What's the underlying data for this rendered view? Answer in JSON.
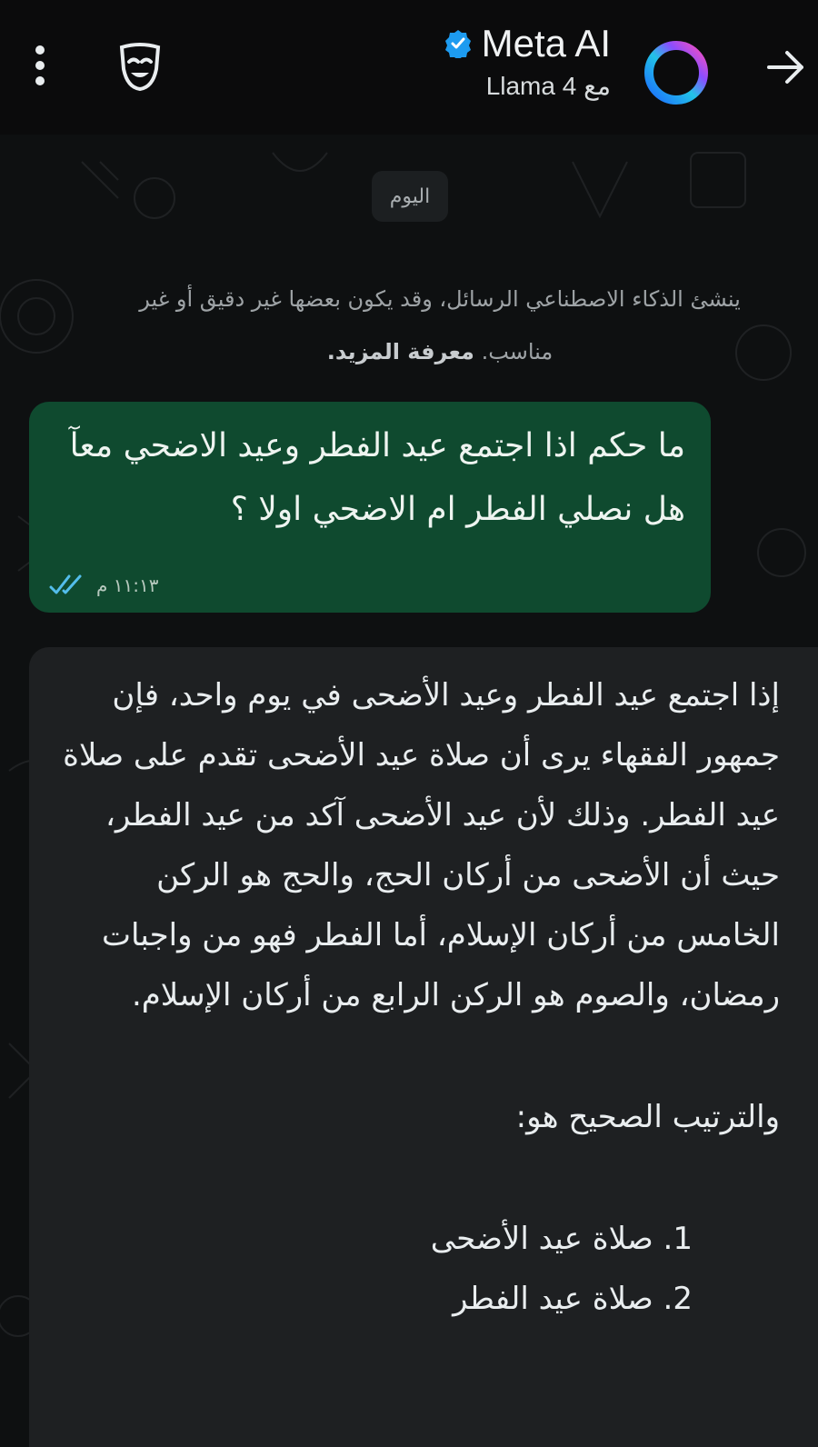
{
  "header": {
    "title": "Meta AI",
    "subtitle": "مع Llama 4",
    "icons": [
      "more-vertical-icon",
      "mask-icon",
      "verified-badge-icon",
      "meta-ai-ring-icon",
      "arrow-right-icon"
    ]
  },
  "chat": {
    "date_chip": "اليوم",
    "notice_text": "ينشئ الذكاء الاصطناعي الرسائل، وقد يكون بعضها غير دقيق أو غير مناسب.",
    "notice_link": "معرفة المزيد.",
    "outgoing": {
      "text": "ما حكم اذا اجتمع عيد الفطر وعيد الاضحي معآ هل نصلي الفطر ام الاضحي اولا ؟",
      "time": "١١:١٣ م",
      "status_icon": "double-check-icon"
    },
    "incoming": {
      "paragraph1": "إذا اجتمع عيد الفطر وعيد الأضحى في يوم واحد، فإن جمهور الفقهاء يرى أن صلاة عيد الأضحى تقدم على صلاة عيد الفطر. وذلك لأن عيد الأضحى آكد من عيد الفطر، حيث أن الأضحى من أركان الحج، والحج هو الركن الخامس من أركان الإسلام، أما الفطر فهو من واجبات رمضان، والصوم هو الركن الرابع من أركان الإسلام.",
      "paragraph2": "والترتيب الصحيح هو:",
      "list": [
        "1. صلاة عيد الأضحى",
        "2. صلاة عيد الفطر"
      ]
    }
  },
  "colors": {
    "background": "#0b0b0b",
    "outgoing_bubble": "#0f4a2f",
    "incoming_bubble": "#1e2022",
    "verified_blue": "#1d9bf0",
    "tick_blue": "#53bdeb"
  }
}
